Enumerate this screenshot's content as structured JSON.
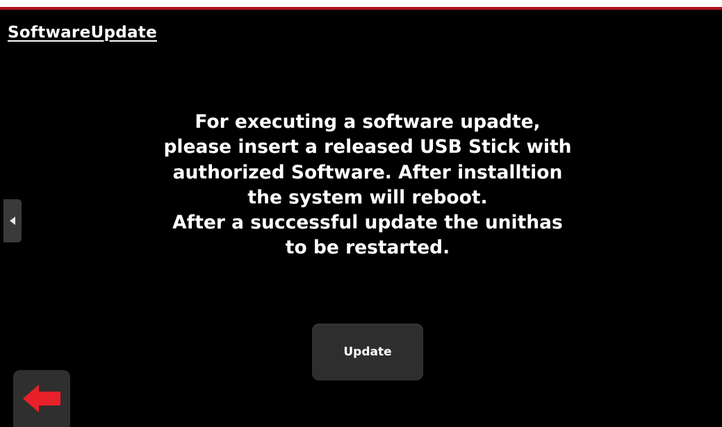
{
  "page": {
    "title": "SoftwareUpdate"
  },
  "message": {
    "paragraph1": "For executing a software upadte, please insert a released USB Stick with authorized Software.  After installtion the system will reboot.",
    "paragraph2": "After a successful update the unithas to be restarted."
  },
  "buttons": {
    "update_label": "Update"
  },
  "icons": {
    "side_tab": "left-triangle-icon",
    "back": "red-left-arrow-icon"
  },
  "colors": {
    "background": "#000000",
    "accent_red": "#b0141c",
    "arrow_red": "#e8202a",
    "button_bg": "#2e2e2e",
    "text": "#ffffff"
  }
}
